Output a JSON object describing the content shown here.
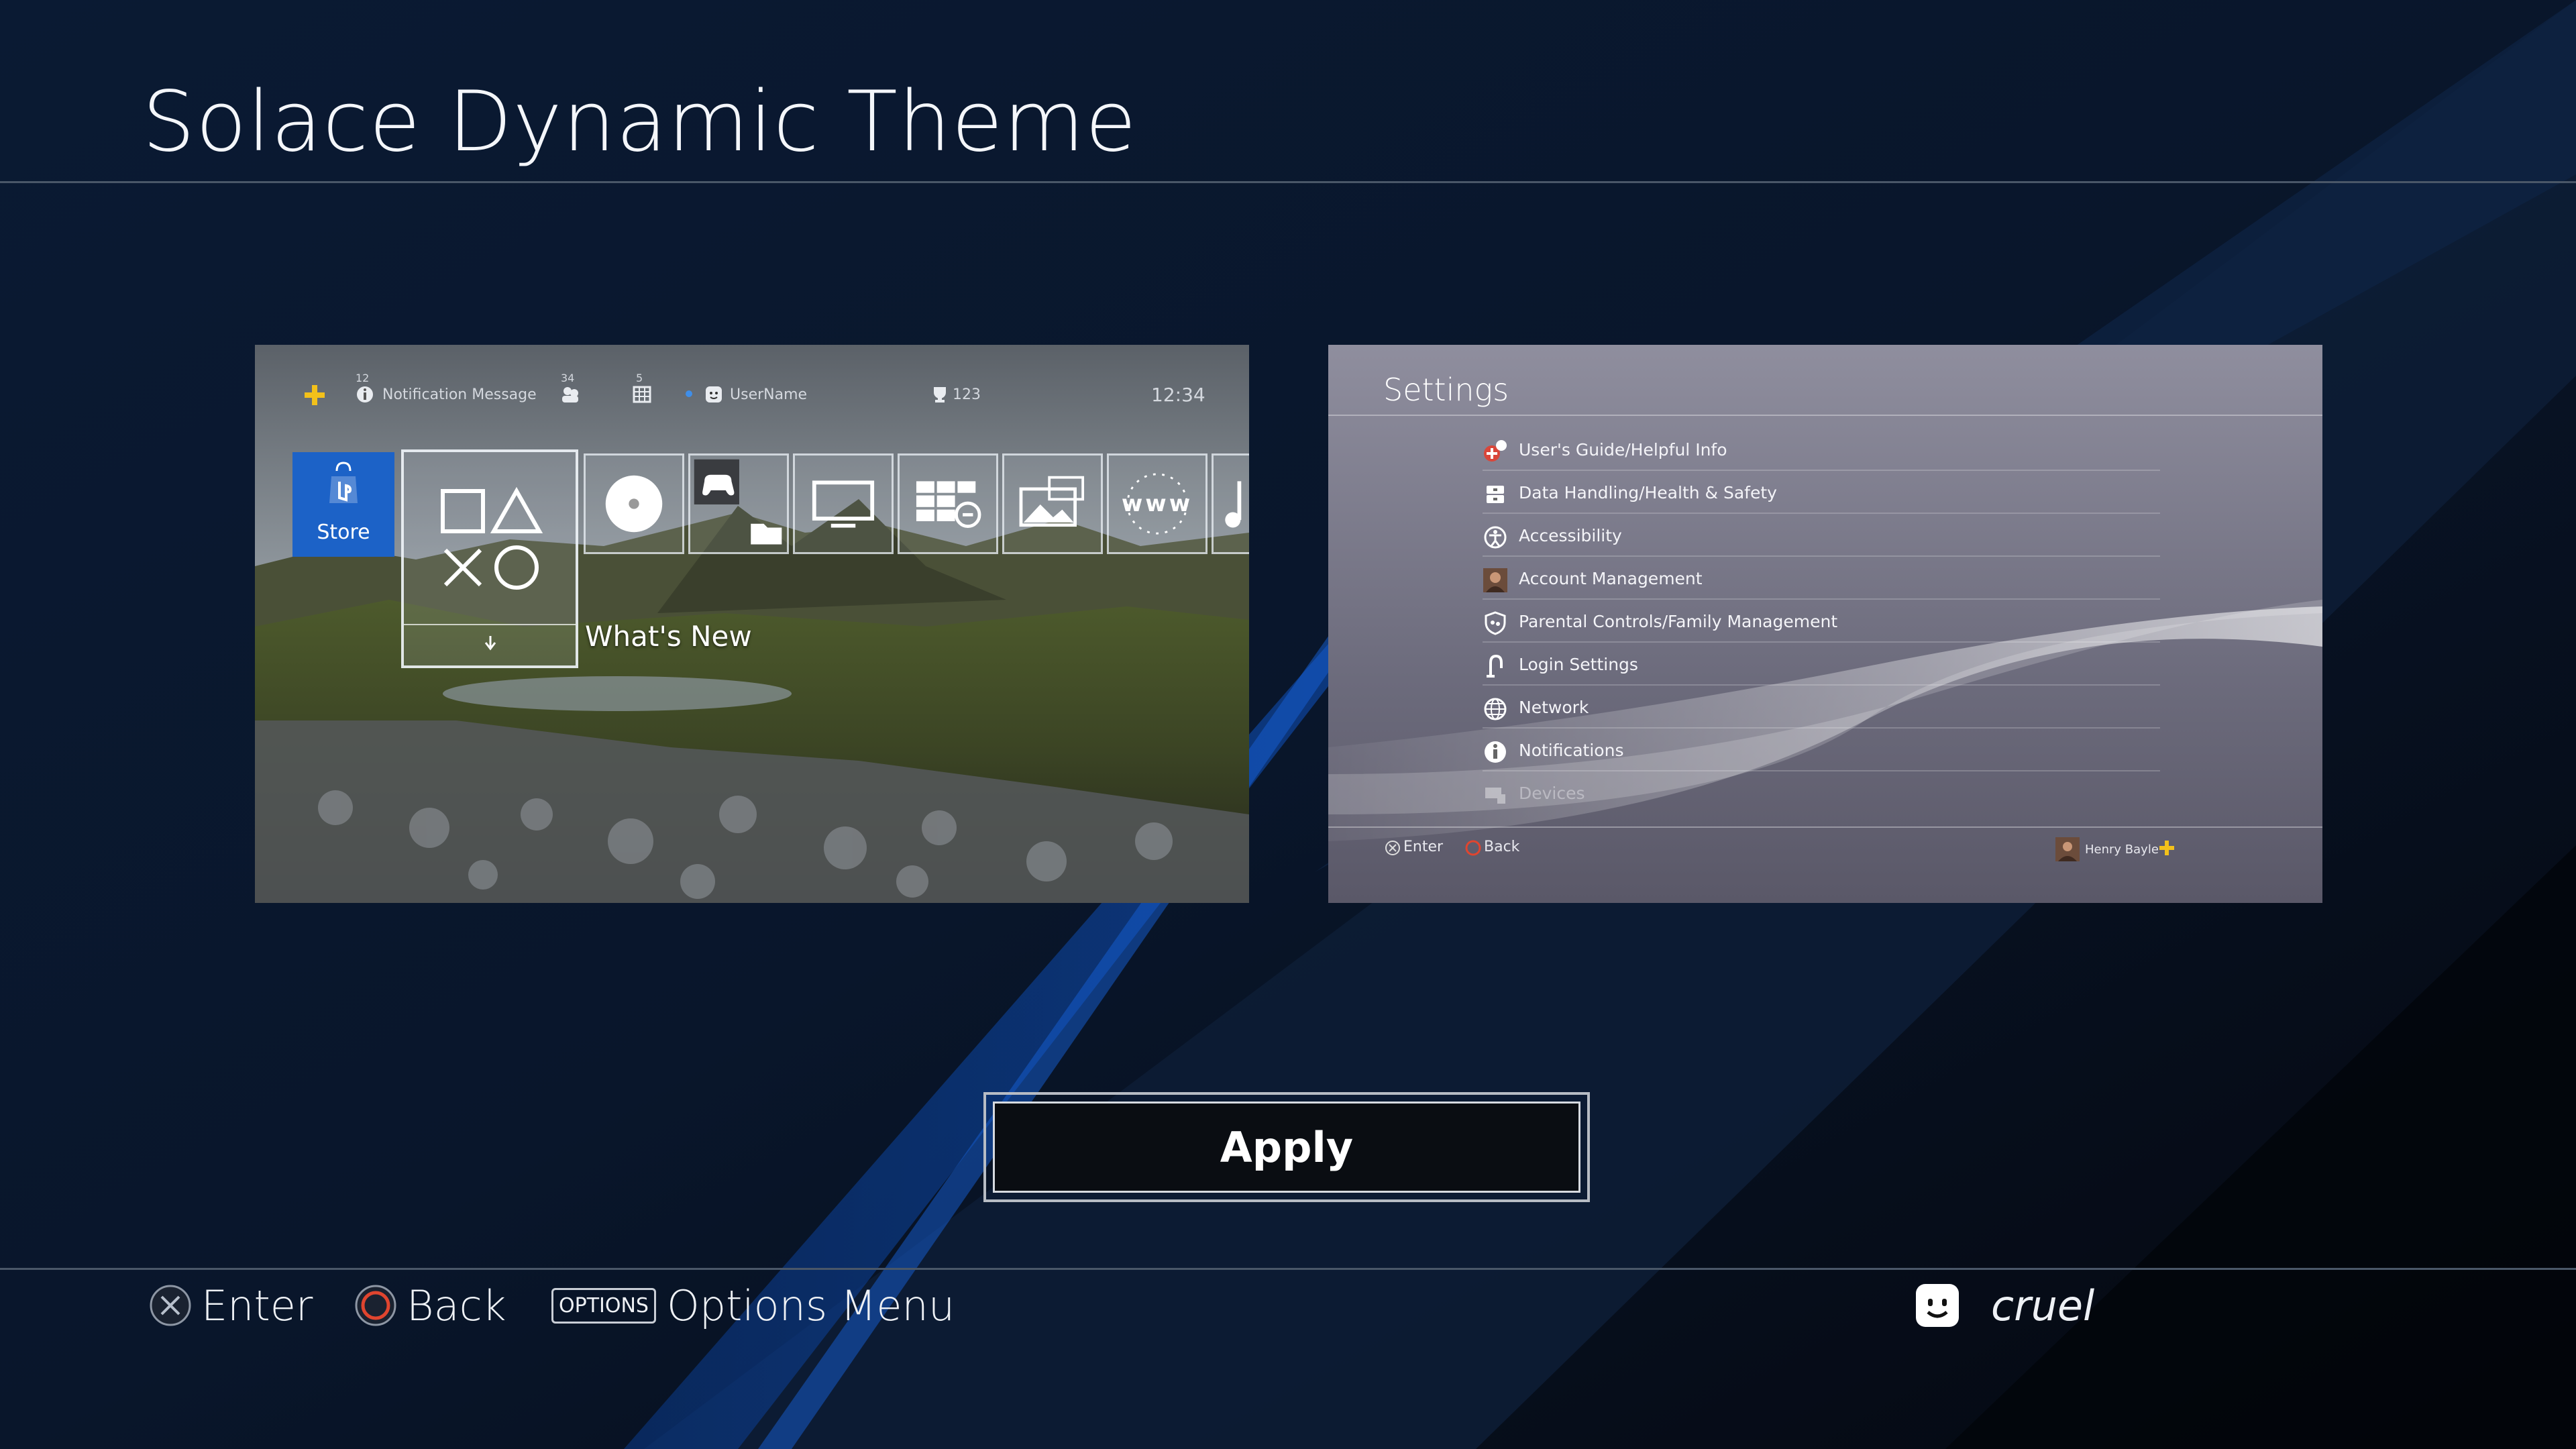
{
  "page": {
    "title": "Solace Dynamic Theme"
  },
  "home_preview": {
    "notification_count": "12",
    "notification_label": "Notification Message",
    "friends_count": "34",
    "messages_count": "5",
    "user_name": "UserName",
    "trophy_count": "123",
    "clock": "12:34",
    "store_label": "Store",
    "whats_new_label": "What's New",
    "www_label": "www"
  },
  "settings_preview": {
    "title": "Settings",
    "items": [
      {
        "label": "User's Guide/Helpful Info",
        "icon": "guide-icon"
      },
      {
        "label": "Data Handling/Health & Safety",
        "icon": "safety-icon"
      },
      {
        "label": "Accessibility",
        "icon": "accessibility-icon"
      },
      {
        "label": "Account Management",
        "icon": "avatar-icon"
      },
      {
        "label": "Parental Controls/Family Management",
        "icon": "shield-icon"
      },
      {
        "label": "Login Settings",
        "icon": "login-icon"
      },
      {
        "label": "Network",
        "icon": "globe-icon"
      },
      {
        "label": "Notifications",
        "icon": "info-icon"
      },
      {
        "label": "Devices",
        "icon": "devices-icon"
      }
    ],
    "footer_enter": "Enter",
    "footer_back": "Back",
    "footer_user": "Henry Bayle"
  },
  "apply_label": "Apply",
  "footer": {
    "enter_label": "Enter",
    "back_label": "Back",
    "options_button_label": "OPTIONS",
    "options_label": "Options Menu",
    "user_name": "cruel"
  },
  "colors": {
    "background": "#06101f",
    "accent_blue": "#1c62c7",
    "circle_button": "#e0452f"
  }
}
